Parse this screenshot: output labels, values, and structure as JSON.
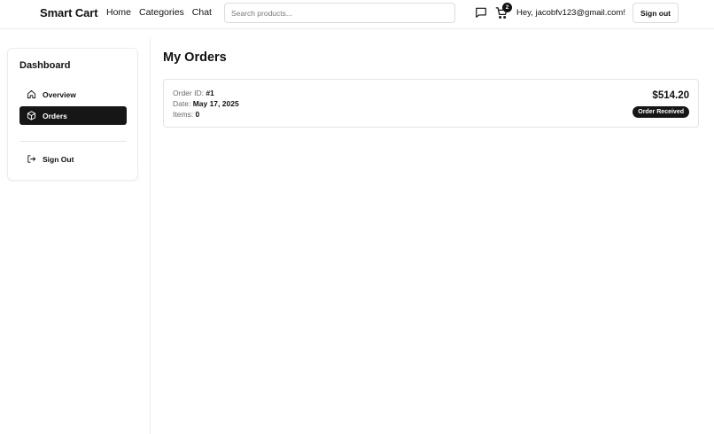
{
  "header": {
    "brand": "Smart Cart",
    "nav": [
      "Home",
      "Categories",
      "Chat"
    ],
    "search_placeholder": "Search products...",
    "cart_count": "2",
    "greeting": "Hey, jacobfv123@gmail.com!",
    "signout_label": "Sign out",
    "icons": {
      "chat": "chat-bubble-icon",
      "cart": "shopping-cart-icon"
    }
  },
  "sidebar": {
    "title": "Dashboard",
    "items": [
      {
        "label": "Overview",
        "icon": "home-icon",
        "active": false
      },
      {
        "label": "Orders",
        "icon": "package-icon",
        "active": true
      },
      {
        "label": "Sign Out",
        "icon": "logout-icon",
        "active": false
      }
    ]
  },
  "main": {
    "title": "My Orders",
    "orders": [
      {
        "id_label": "Order ID:",
        "id": "#1",
        "date_label": "Date:",
        "date": "May 17, 2025",
        "items_label": "Items:",
        "items": "0",
        "total": "$514.20",
        "status": "Order Received"
      }
    ]
  },
  "colors": {
    "accent": "#161616",
    "border": "#e4e4e4",
    "muted_text": "#6a6a6a"
  }
}
